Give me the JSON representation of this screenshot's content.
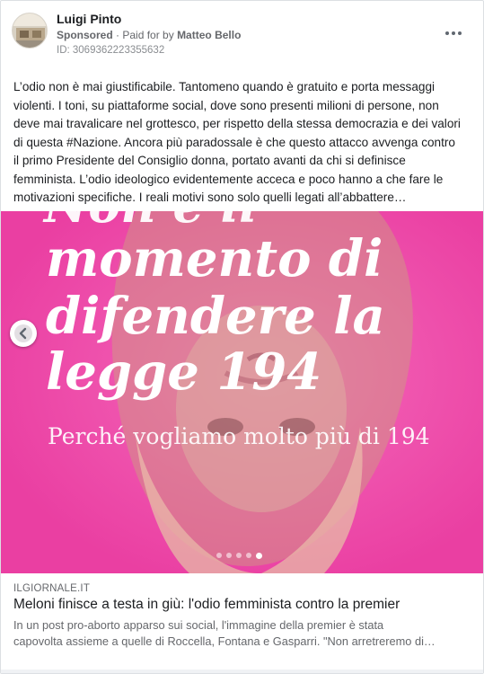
{
  "post": {
    "author": "Luigi Pinto",
    "sponsored_label": "Sponsored",
    "paid_for_prefix": "· Paid for by",
    "paid_for_name": "Matteo Bello",
    "ad_id": "ID: 3069362223355632",
    "more_icon": "more-horizontal-icon",
    "body_lines": [
      "L’odio non è mai giustificabile. Tantomeno quando è gratuito e porta messaggi",
      "violenti. I toni, su piattaforme social, dove sono presenti milioni di persone, non",
      "deve mai travalicare nel grottesco, per rispetto della stessa democrazia e dei valori",
      "di questa #Nazione. Ancora più paradossale è che questo attacco avvenga contro",
      "il primo Presidente del Consiglio donna, portato avanti da chi si definisce",
      "femminista. L’odio ideologico evidentemente acceca e poco hanno a che fare le",
      "motivazioni specifiche. I reali motivi sono solo quelli legati all’abbattere…"
    ]
  },
  "carousel": {
    "background_color": "#f04fae",
    "headline_partial": "Non è il",
    "headline_lines": [
      "momento di",
      "difendere la",
      "legge 194"
    ],
    "subline": "Perché vogliamo molto più di 194",
    "prev_icon": "chevron-left-icon",
    "dot_count": 5,
    "active_dot": 4
  },
  "link": {
    "domain": "ILGIORNALE.IT",
    "title": "Meloni finisce a testa in giù: l'odio femminista contro la premier",
    "description_lines": [
      "In un post pro-aborto apparso sui social, l'immagine della premier è stata",
      "capovolta assieme a quelle di Roccella, Fontana e Gasparri. \"Non arretreremo di…"
    ]
  }
}
